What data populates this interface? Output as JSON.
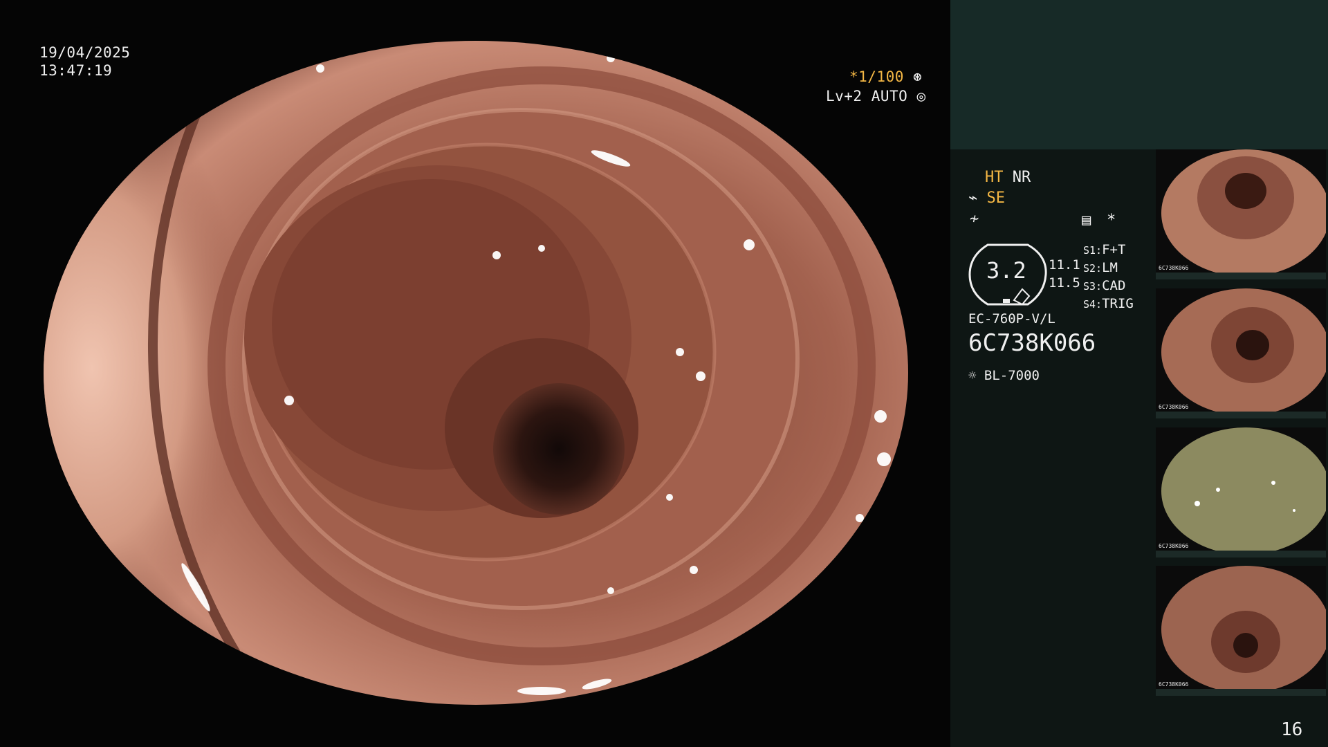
{
  "overlay": {
    "date": "19/04/2025",
    "time": "13:47:19",
    "shutter": "*1/100",
    "shutter_icon": "aperture-icon",
    "level": "Lv+2",
    "mode": "AUTO",
    "mode_icon": "auto-iris-icon"
  },
  "panel": {
    "ht_label": "HT",
    "nr_label": "NR",
    "se_label": "SE",
    "se_icon": "enhance-curve-icon",
    "f_icon": "function-icon",
    "menu_icon": "settings-list-icon",
    "star": "*",
    "dial_value": "3.2",
    "values": [
      "11.1",
      "11.5"
    ],
    "switches": [
      {
        "key": "S1:",
        "value": "F+T"
      },
      {
        "key": "S2:",
        "value": "LM"
      },
      {
        "key": "S3:",
        "value": "CAD"
      },
      {
        "key": "S4:",
        "value": "TRIG"
      }
    ],
    "scope_model": "EC-760P-V/L",
    "serial": "6C738K066",
    "light_icon": "light-source-icon",
    "light_source": "BL-7000",
    "page_number": "16"
  },
  "thumbnails": [
    {
      "caption": "6C738K066",
      "tone": "#b47a62"
    },
    {
      "caption": "6C738K066",
      "tone": "#a66b55"
    },
    {
      "caption": "6C738K066",
      "tone": "#8c8a60"
    },
    {
      "caption": "6C738K066",
      "tone": "#9c6450"
    }
  ],
  "colors": {
    "accent_amber": "#f5b845",
    "panel_bg": "#0e1614",
    "panel_top_bg": "#172a27",
    "tissue": "#b06a55"
  }
}
